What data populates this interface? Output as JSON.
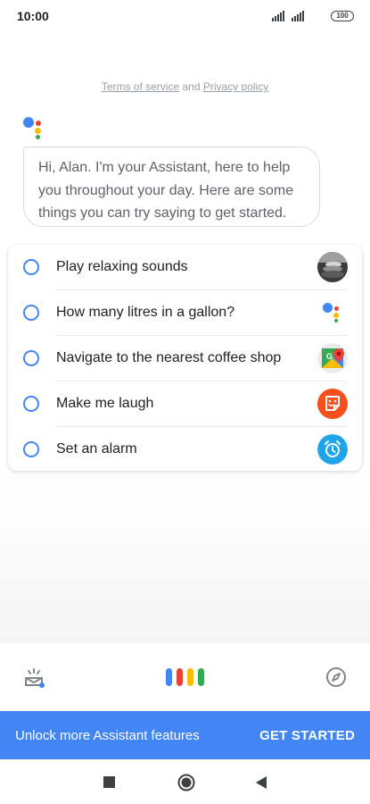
{
  "status_bar": {
    "time": "10:00",
    "battery": "100"
  },
  "terms": {
    "terms_link": "Terms of service",
    "and": "and",
    "privacy_link": "Privacy policy"
  },
  "greeting": {
    "text": "Hi, Alan. I'm your Assistant, here to help you throughout your day. Here are some things you can try saying to get started."
  },
  "suggestions": [
    {
      "label": "Play relaxing sounds",
      "icon": "relaxing-sounds-thumbnail-icon"
    },
    {
      "label": "How many litres in a gallon?",
      "icon": "google-assistant-icon"
    },
    {
      "label": "Navigate to the nearest coffee shop",
      "icon": "google-maps-icon"
    },
    {
      "label": "Make me laugh",
      "icon": "sticker-face-icon"
    },
    {
      "label": "Set an alarm",
      "icon": "alarm-clock-icon"
    }
  ],
  "toolbar": {
    "left_icon": "snapshot-tray-icon",
    "center_icon": "voice-mic-bars-icon",
    "right_icon": "explore-compass-icon"
  },
  "banner": {
    "text": "Unlock more Assistant features",
    "button": "GET STARTED"
  },
  "colors": {
    "blue": "#4285f4",
    "red": "#ea4335",
    "yellow": "#fbbc05",
    "green": "#34a853"
  }
}
